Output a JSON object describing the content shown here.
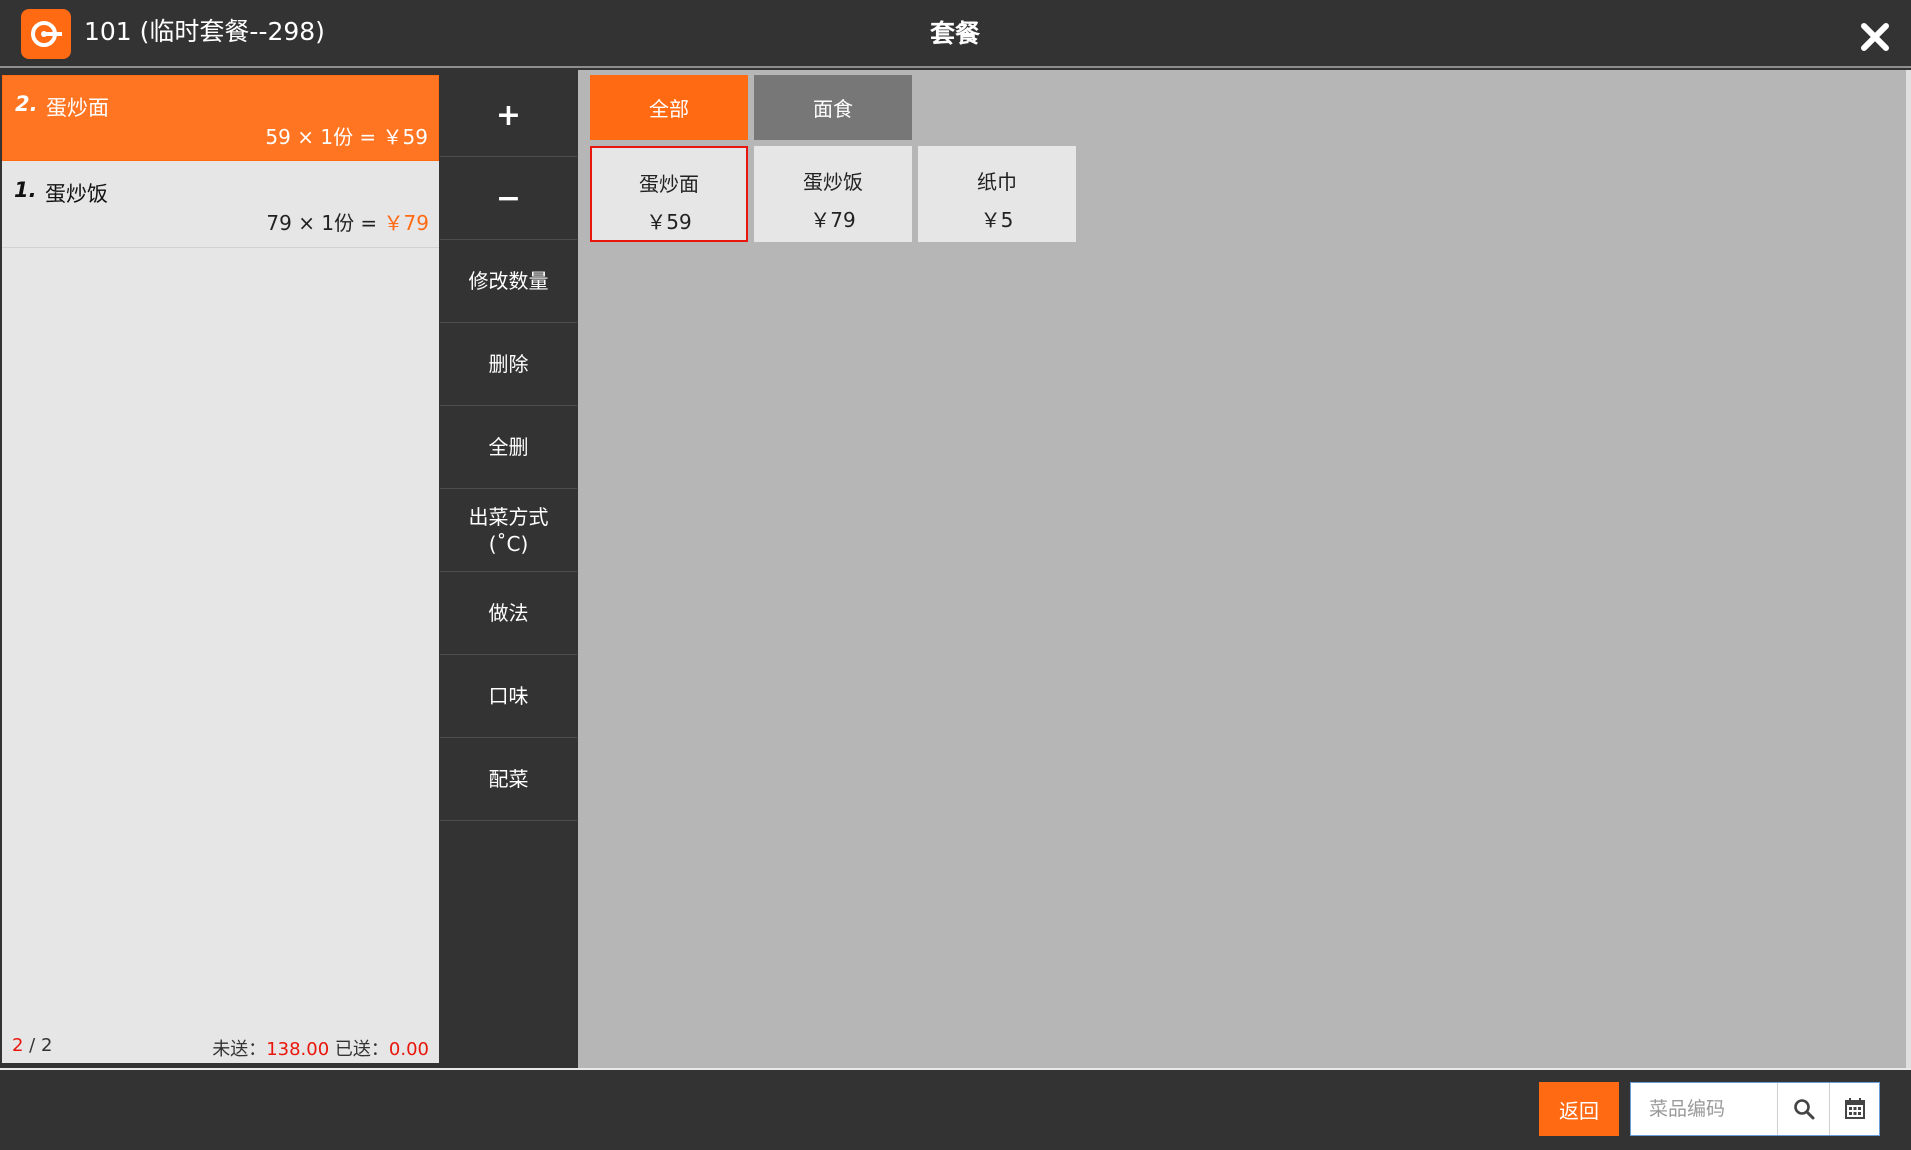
{
  "header": {
    "title": "101 (临时套餐--298)",
    "center_title": "套餐"
  },
  "order": {
    "items": [
      {
        "index": "2.",
        "name": "蛋炒面",
        "calc": "59 × 1份 = ",
        "total": "￥59",
        "selected": true
      },
      {
        "index": "1.",
        "name": "蛋炒饭",
        "calc": "79 × 1份 = ",
        "total": "￥79",
        "selected": false
      }
    ],
    "pager_current": "2",
    "pager_separator": " / ",
    "pager_total": "2",
    "unsent_label": "未送：",
    "unsent_value": "138.00",
    "sent_label": " 已送：",
    "sent_value": "0.00"
  },
  "actions": [
    {
      "label": "+"
    },
    {
      "label": "−"
    },
    {
      "label": "修改数量"
    },
    {
      "label": "删除"
    },
    {
      "label": "全删"
    },
    {
      "label": "出菜方式(˚C)"
    },
    {
      "label": "做法"
    },
    {
      "label": "口味"
    },
    {
      "label": "配菜"
    }
  ],
  "categories": [
    {
      "label": "全部",
      "active": true
    },
    {
      "label": "面食",
      "active": false
    }
  ],
  "dishes": [
    {
      "name": "蛋炒面",
      "price": "￥59",
      "selected": true
    },
    {
      "name": "蛋炒饭",
      "price": "￥79",
      "selected": false
    },
    {
      "name": "纸巾",
      "price": "￥5",
      "selected": false
    }
  ],
  "bottom": {
    "return_label": "返回",
    "search_placeholder": "菜品编码",
    "search_icon": "search-icon",
    "calendar_icon": "calendar-icon"
  },
  "colors": {
    "accent": "#ff6a13",
    "dark": "#333333",
    "red": "#e8160c"
  }
}
